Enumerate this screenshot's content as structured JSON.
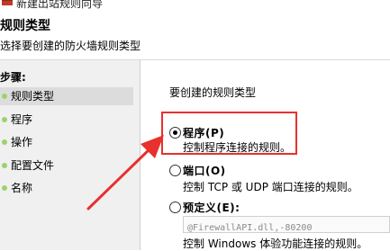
{
  "window": {
    "title": "新建出站规则向导"
  },
  "header": {
    "title": "规则类型",
    "subtitle": "选择要创建的防火墙规则类型"
  },
  "steps": {
    "title": "步骤:",
    "items": [
      {
        "label": "规则类型",
        "active": true
      },
      {
        "label": "程序"
      },
      {
        "label": "操作"
      },
      {
        "label": "配置文件"
      },
      {
        "label": "名称"
      }
    ]
  },
  "main": {
    "question": "要创建的规则类型",
    "options": [
      {
        "label": "程序(P)",
        "description": "控制程序连接的规则。",
        "selected": true
      },
      {
        "label": "端口(O)",
        "description": "控制 TCP 或 UDP 端口连接的规则。",
        "selected": false
      },
      {
        "label": "预定义(E):",
        "field_value": "@FirewallAPI.dll,-80200",
        "description": "控制 Windows 体验功能连接的规则。",
        "selected": false
      }
    ]
  },
  "colors": {
    "highlight": "#e8302c",
    "step_bullet": "#9bd36a",
    "panel_bg": "#f0f0f0"
  }
}
